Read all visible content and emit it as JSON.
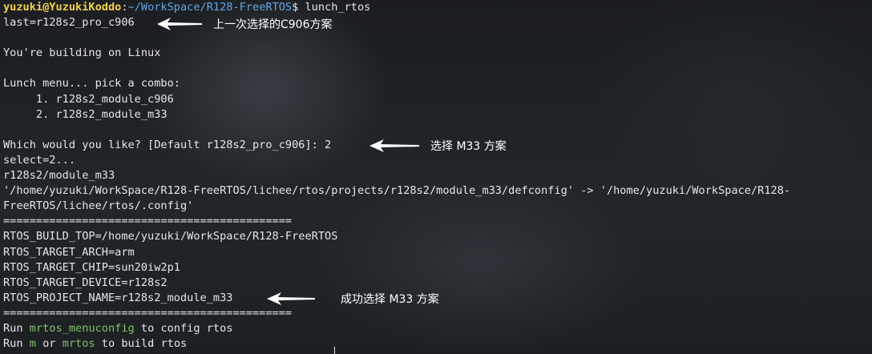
{
  "prompt": {
    "user_host": "yuzuki@YuzukiKoddo",
    "sep": ":",
    "cwd": "~/WorkSpace/R128-FreeRTOS",
    "dollar": "$ ",
    "command": "lunch_rtos"
  },
  "lines": [
    "last=r128s2_pro_c906",
    "",
    "You're building on Linux",
    "",
    "Lunch menu... pick a combo:",
    "     1. r128s2_module_c906",
    "     2. r128s2_module_m33",
    "",
    "Which would you like? [Default r128s2_pro_c906]: 2",
    "select=2...",
    "r128s2/module_m33",
    "'/home/yuzuki/WorkSpace/R128-FreeRTOS/lichee/rtos/projects/r128s2/module_m33/defconfig' -> '/home/yuzuki/WorkSpace/R128-",
    "FreeRTOS/lichee/rtos/.config'",
    "============================================",
    "RTOS_BUILD_TOP=/home/yuzuki/WorkSpace/R128-FreeRTOS",
    "RTOS_TARGET_ARCH=arm",
    "RTOS_TARGET_CHIP=sun20iw2p1",
    "RTOS_TARGET_DEVICE=r128s2",
    "RTOS_PROJECT_NAME=r128s2_module_m33",
    "============================================"
  ],
  "run_lines": [
    {
      "prefix": "Run ",
      "cmd": "mrtos_menuconfig",
      "suffix": " to config rtos"
    },
    {
      "prefix": "Run ",
      "cmd": "m",
      "mid": " or ",
      "cmd2": "mrtos",
      "suffix": " to build rtos"
    }
  ],
  "annotations": {
    "previous_choice": "上一次选择的C906方案",
    "choose_m33": "选择 M33 方案",
    "chosen_m33": "成功选择 M33 方案"
  }
}
